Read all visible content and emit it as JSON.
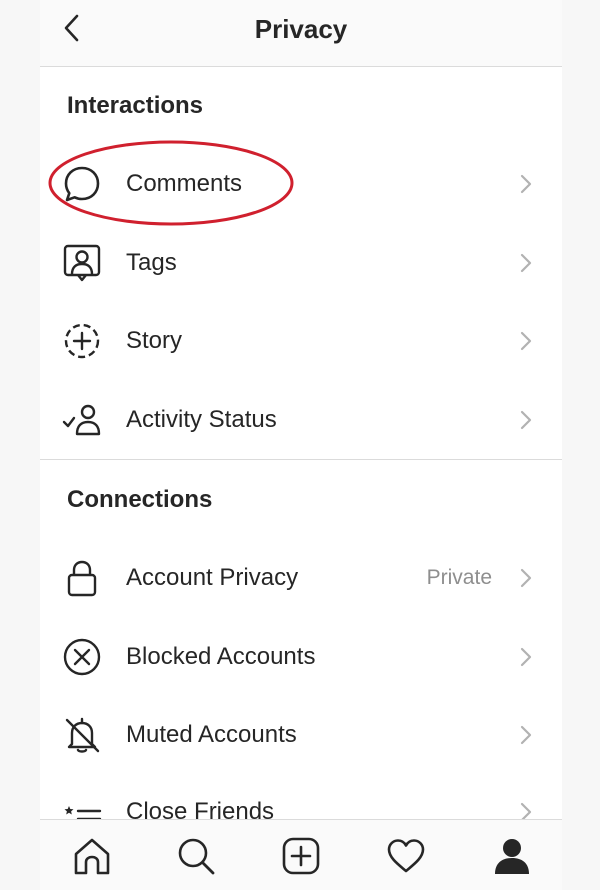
{
  "header": {
    "title": "Privacy",
    "back_icon": "chevron-left-icon"
  },
  "sections": [
    {
      "title": "Interactions",
      "items": [
        {
          "label": "Comments",
          "icon": "comment-bubble-icon",
          "highlighted": true
        },
        {
          "label": "Tags",
          "icon": "tag-person-icon"
        },
        {
          "label": "Story",
          "icon": "story-add-icon"
        },
        {
          "label": "Activity Status",
          "icon": "activity-status-icon"
        }
      ]
    },
    {
      "title": "Connections",
      "items": [
        {
          "label": "Account Privacy",
          "value": "Private",
          "icon": "lock-icon"
        },
        {
          "label": "Blocked Accounts",
          "icon": "blocked-x-icon"
        },
        {
          "label": "Muted Accounts",
          "icon": "muted-bell-icon"
        },
        {
          "label": "Close Friends",
          "icon": "close-friends-list-icon"
        }
      ]
    }
  ],
  "bottom_nav": [
    {
      "name": "home-icon"
    },
    {
      "name": "search-icon"
    },
    {
      "name": "new-post-icon"
    },
    {
      "name": "activity-heart-icon"
    },
    {
      "name": "profile-icon"
    }
  ],
  "colors": {
    "highlight": "#d0202e",
    "text": "#262626",
    "secondary_text": "#8e8e8e",
    "chevron": "#b2b2b2",
    "divider": "#dbdbdb"
  }
}
